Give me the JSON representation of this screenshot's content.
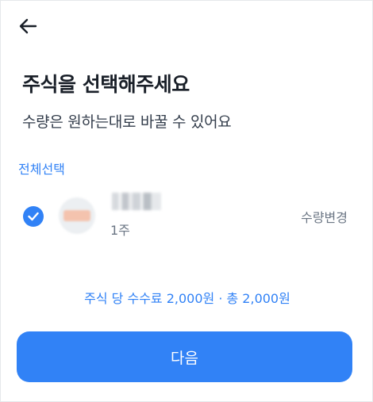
{
  "header": {
    "back_icon": "arrow-left-icon"
  },
  "main": {
    "title": "주식을 선택해주세요",
    "subtitle": "수량은 원하는대로 바꿀 수 있어요",
    "select_all_label": "전체선택"
  },
  "stock_list": [
    {
      "checked": true,
      "check_icon": "check-icon",
      "logo": "stock-logo-icon",
      "quantity": "1주",
      "change_label": "수량변경"
    }
  ],
  "summary": {
    "fee_text": "주식 당 수수료 2,000원 · 총 2,000원"
  },
  "footer": {
    "next_label": "다음"
  },
  "colors": {
    "accent": "#3182f6",
    "text_primary": "#191f28",
    "text_secondary": "#6b7684"
  }
}
